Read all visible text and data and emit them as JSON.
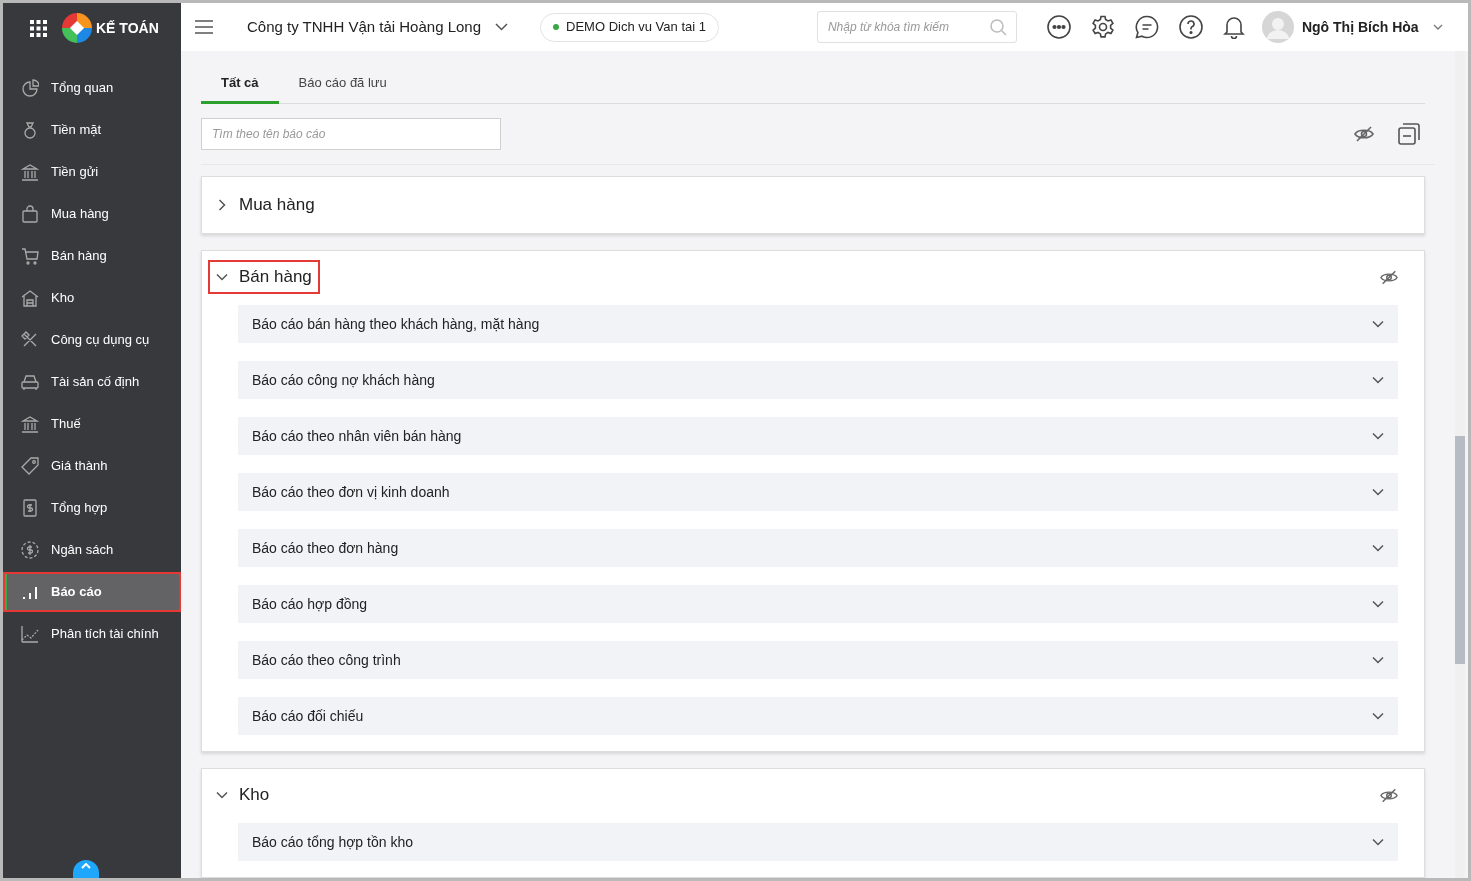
{
  "app": {
    "logo_text": "KẾ TOÁN"
  },
  "sidebar": {
    "items": [
      {
        "label": "Tổng quan",
        "selected": false,
        "highlighted": false
      },
      {
        "label": "Tiền mặt",
        "selected": false,
        "highlighted": false
      },
      {
        "label": "Tiền gửi",
        "selected": false,
        "highlighted": false
      },
      {
        "label": "Mua hàng",
        "selected": false,
        "highlighted": false
      },
      {
        "label": "Bán hàng",
        "selected": false,
        "highlighted": false
      },
      {
        "label": "Kho",
        "selected": false,
        "highlighted": false
      },
      {
        "label": "Công cụ dụng cụ",
        "selected": false,
        "highlighted": false
      },
      {
        "label": "Tài sản cố định",
        "selected": false,
        "highlighted": false
      },
      {
        "label": "Thuế",
        "selected": false,
        "highlighted": false
      },
      {
        "label": "Giá thành",
        "selected": false,
        "highlighted": false
      },
      {
        "label": "Tổng hợp",
        "selected": false,
        "highlighted": false
      },
      {
        "label": "Ngân sách",
        "selected": false,
        "highlighted": false
      },
      {
        "label": "Báo cáo",
        "selected": true,
        "highlighted": true
      },
      {
        "label": "Phân tích tài chính",
        "selected": false,
        "highlighted": false
      }
    ]
  },
  "header": {
    "company": "Công ty TNHH Vận tải Hoàng Long",
    "database": "DEMO Dich vu Van tai 1",
    "search": {
      "placeholder": "Nhập từ khóa tìm kiếm"
    },
    "user": "Ngô Thị Bích Hòa"
  },
  "tabs": [
    {
      "label": "Tất cả",
      "selected": true
    },
    {
      "label": "Báo cáo đã lưu",
      "selected": false
    }
  ],
  "report_search": {
    "placeholder": "Tìm theo tên báo cáo"
  },
  "sections": [
    {
      "title": "Mua hàng",
      "expanded": false,
      "highlighted": false
    },
    {
      "title": "Bán hàng",
      "expanded": true,
      "highlighted": true,
      "reports": [
        "Báo cáo bán hàng theo khách hàng, mặt hàng",
        "Báo cáo công nợ khách hàng",
        "Báo cáo theo nhân viên bán hàng",
        "Báo cáo theo đơn vị kinh doanh",
        "Báo cáo theo đơn hàng",
        "Báo cáo hợp đồng",
        "Báo cáo theo công trình",
        "Báo cáo đối chiếu"
      ]
    },
    {
      "title": "Kho",
      "expanded": true,
      "highlighted": false,
      "reports": [
        "Báo cáo tổng hợp tồn kho"
      ]
    }
  ]
}
